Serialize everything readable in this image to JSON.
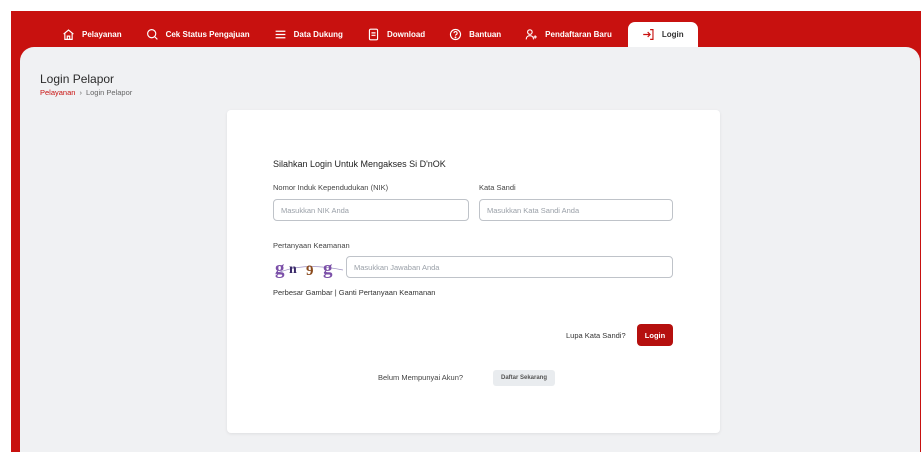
{
  "nav": {
    "items": [
      {
        "label": "Pelayanan",
        "icon": "home-icon"
      },
      {
        "label": "Cek Status Pengajuan",
        "icon": "search-icon"
      },
      {
        "label": "Data Dukung",
        "icon": "list-icon"
      },
      {
        "label": "Download",
        "icon": "document-icon"
      },
      {
        "label": "Bantuan",
        "icon": "help-circle-icon"
      },
      {
        "label": "Pendaftaran Baru",
        "icon": "user-plus-icon"
      }
    ],
    "active": {
      "label": "Login",
      "icon": "login-icon"
    }
  },
  "page": {
    "title": "Login Pelapor",
    "breadcrumb": {
      "link": "Pelayanan",
      "separator": "›",
      "current": "Login Pelapor"
    }
  },
  "form": {
    "heading": "Silahkan Login Untuk Mengakses Si D'nOK",
    "nik": {
      "label": "Nomor Induk Kependudukan (NIK)",
      "placeholder": "Masukkan NIK Anda",
      "value": ""
    },
    "password": {
      "label": "Kata Sandi",
      "placeholder": "Masukkan Kata Sandi Anda",
      "value": ""
    },
    "security": {
      "label": "Pertanyaan Keamanan",
      "captcha_text": "gn9g",
      "placeholder": "Masukkan Jawaban Anda",
      "value": ""
    },
    "enlarge_link": "Perbesar Gambar",
    "links_separator": "|",
    "change_question_link": "Ganti Pertanyaan Keamanan",
    "forgot_password": "Lupa Kata Sandi?",
    "login_button": "Login",
    "no_account_text": "Belum Mempunyai Akun?",
    "register_button": "Daftar Sekarang"
  },
  "colors": {
    "brand_red": "#c8110f",
    "button_red": "#b5100e",
    "background": "#f0f1f3",
    "captcha_purple": "#7b4fa8",
    "captcha_brown": "#8a4a1c"
  }
}
